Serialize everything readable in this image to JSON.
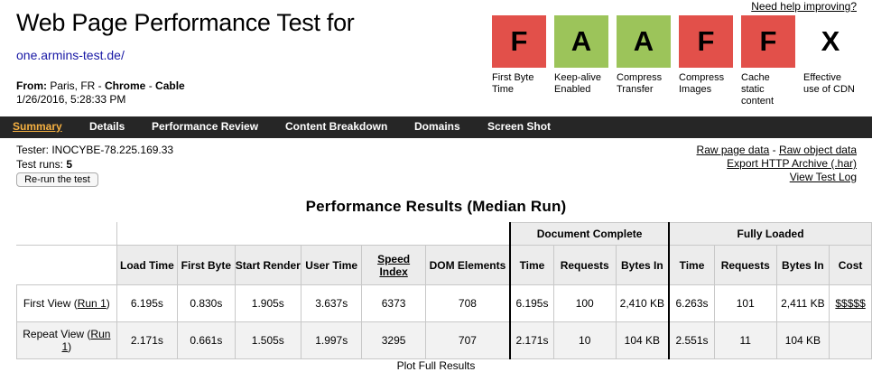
{
  "header": {
    "title": "Web Page Performance Test for",
    "site": "one.armins-test.de/",
    "from_label": "From:",
    "from_location": "Paris, FR - ",
    "browser": "Chrome",
    "sep": " - ",
    "connection": "Cable",
    "date": "1/26/2016, 5:28:33 PM",
    "help_link": "Need help improving?"
  },
  "grades": [
    {
      "letter": "F",
      "label": "First Byte Time",
      "color": "#e2504a"
    },
    {
      "letter": "A",
      "label": "Keep-alive Enabled",
      "color": "#9cc45a"
    },
    {
      "letter": "A",
      "label": "Compress Transfer",
      "color": "#9cc45a"
    },
    {
      "letter": "F",
      "label": "Compress Images",
      "color": "#e2504a"
    },
    {
      "letter": "F",
      "label": "Cache static content",
      "color": "#e2504a"
    },
    {
      "letter": "X",
      "label": "Effective use of CDN",
      "color": "#ffffff"
    }
  ],
  "nav": [
    "Summary",
    "Details",
    "Performance Review",
    "Content Breakdown",
    "Domains",
    "Screen Shot"
  ],
  "tester": "Tester: INOCYBE-78.225.169.33",
  "runs_label": "Test runs: ",
  "runs_value": "5",
  "rerun_button": "Re-run the test",
  "right_links": [
    "Raw page data",
    " - ",
    "Raw object data",
    "Export HTTP Archive (.har)",
    "View Test Log"
  ],
  "results_title": "Performance Results (Median Run)",
  "table": {
    "group_doc": "Document Complete",
    "group_full": "Fully Loaded",
    "headers": [
      "Load Time",
      "First Byte",
      "Start Render",
      "User Time",
      "Speed Index",
      "DOM Elements",
      "Time",
      "Requests",
      "Bytes In",
      "Time",
      "Requests",
      "Bytes In",
      "Cost"
    ],
    "rows": [
      {
        "label": "First View (",
        "run": "Run 1",
        "close": ")",
        "cells": [
          "6.195s",
          "0.830s",
          "1.905s",
          "3.637s",
          "6373",
          "708",
          "6.195s",
          "100",
          "2,410 KB",
          "6.263s",
          "101",
          "2,411 KB",
          "$$$$$"
        ]
      },
      {
        "label": "Repeat View (",
        "run": "Run 1",
        "close": ")",
        "cells": [
          "2.171s",
          "0.661s",
          "1.505s",
          "1.997s",
          "3295",
          "707",
          "2.171s",
          "10",
          "104 KB",
          "2.551s",
          "11",
          "104 KB",
          ""
        ]
      }
    ]
  },
  "plot_link": "Plot Full Results"
}
